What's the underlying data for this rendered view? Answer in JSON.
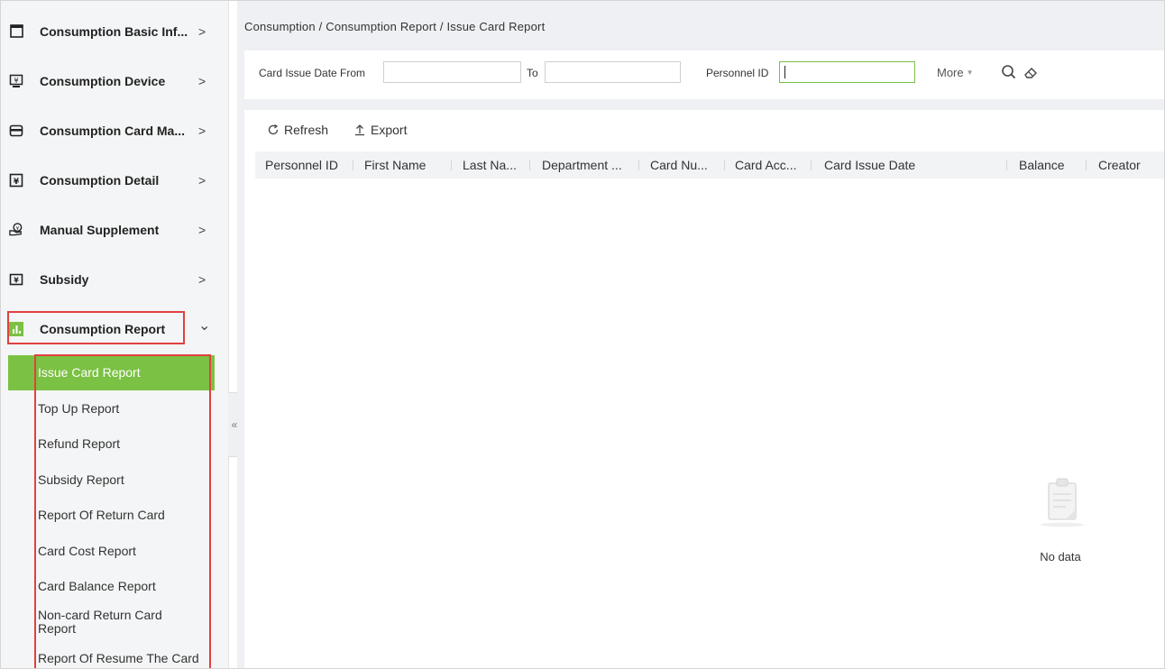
{
  "sidebar": {
    "menu": [
      {
        "label": "Consumption Basic Inf...",
        "icon": "window-icon",
        "chevron": ">"
      },
      {
        "label": "Consumption Device",
        "icon": "device-icon",
        "chevron": ">"
      },
      {
        "label": "Consumption Card Ma...",
        "icon": "card-icon",
        "chevron": ">"
      },
      {
        "label": "Consumption Detail",
        "icon": "yen-document-icon",
        "chevron": ">"
      },
      {
        "label": "Manual Supplement",
        "icon": "hand-coin-icon",
        "chevron": ">"
      },
      {
        "label": "Subsidy",
        "icon": "subsidy-icon",
        "chevron": ">"
      },
      {
        "label": "Consumption Report",
        "icon": "bar-chart-icon",
        "chevron": "⌄"
      }
    ],
    "submenu": [
      {
        "label": "Issue Card Report",
        "active": true
      },
      {
        "label": "Top Up Report"
      },
      {
        "label": "Refund Report"
      },
      {
        "label": "Subsidy Report"
      },
      {
        "label": "Report Of Return Card"
      },
      {
        "label": "Card Cost Report"
      },
      {
        "label": "Card Balance Report"
      },
      {
        "label": "Non-card Return Card Report"
      },
      {
        "label": "Report Of Resume The Card"
      }
    ],
    "collapse_glyph": "«"
  },
  "breadcrumb": "Consumption / Consumption Report / Issue Card Report",
  "filters": {
    "date_from_label": "Card Issue Date From",
    "date_from_value": "",
    "to_label": "To",
    "to_value": "",
    "personnel_id_label": "Personnel ID",
    "personnel_id_value": "",
    "more_label": "More"
  },
  "toolbar": {
    "refresh_label": "Refresh",
    "export_label": "Export"
  },
  "table": {
    "columns": [
      "Personnel ID",
      "First Name",
      "Last Na...",
      "Department ...",
      "Card Nu...",
      "Card Acc...",
      "Card Issue Date",
      "Balance",
      "Creator"
    ],
    "rows": [],
    "empty_text": "No data"
  },
  "colors": {
    "accent": "#7bc144",
    "highlight_border": "#e0413f",
    "sidebar_bg": "#f4f5f6",
    "main_bg": "#eef0f3"
  }
}
